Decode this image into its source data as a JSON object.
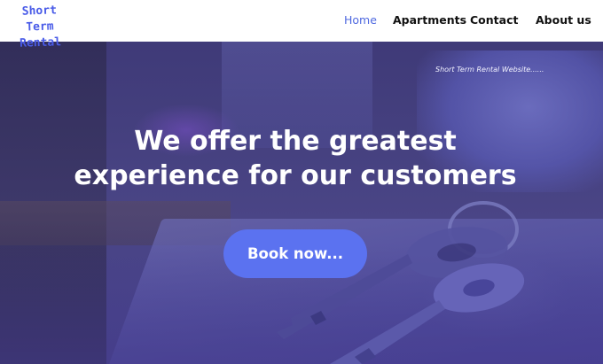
{
  "header": {
    "logo_line1": "Short Term",
    "logo_line2": "Rental",
    "nav": {
      "home": "Home",
      "apartments": "Apartments",
      "contact": "Contact",
      "about": "About us"
    }
  },
  "hero": {
    "tagline": "Short Term Rental Website......",
    "heading_line1": "We offer the greatest",
    "heading_line2": "experience for our customers",
    "book_button": "Book now..."
  },
  "colors": {
    "accent": "#4f69e0",
    "button": "#5b72f0",
    "logo": "#4a5ce8"
  },
  "icons": {
    "hero_image": "keys-on-table-photo"
  }
}
